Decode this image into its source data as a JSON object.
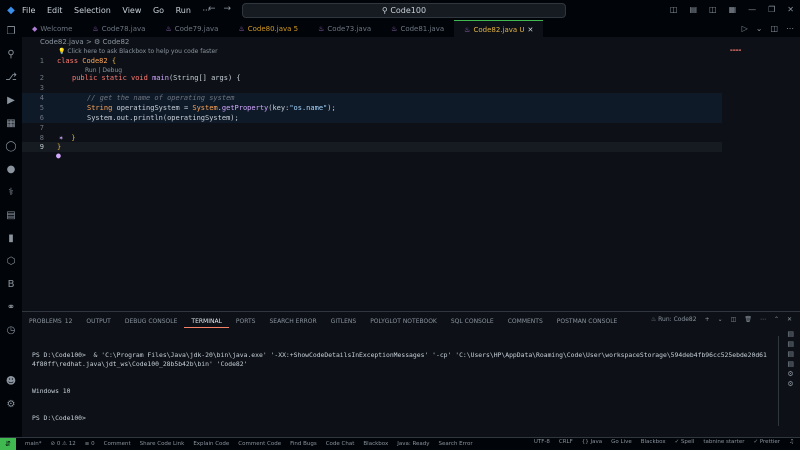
{
  "titlebar": {
    "menu": [
      "File",
      "Edit",
      "Selection",
      "View",
      "Go",
      "Run",
      "···"
    ],
    "search": "Code100"
  },
  "tabs": [
    {
      "label": "Welcome",
      "icon": "vscode-icon",
      "active": false,
      "modified": false
    },
    {
      "label": "Code78.java",
      "icon": "java-icon",
      "active": false,
      "modified": false
    },
    {
      "label": "Code79.java",
      "icon": "java-icon",
      "active": false,
      "modified": false
    },
    {
      "label": "Code80.java 5",
      "icon": "java-icon",
      "active": false,
      "modified": true
    },
    {
      "label": "Code73.java",
      "icon": "java-icon",
      "active": false,
      "modified": false
    },
    {
      "label": "Code81.java",
      "icon": "java-icon",
      "active": false,
      "modified": false
    },
    {
      "label": "Code82.java U",
      "icon": "java-icon",
      "active": true,
      "modified": true
    }
  ],
  "breadcrumb": "Code82.java > ⚙ Code82",
  "editor": {
    "hint": "💡 Click here to ask Blackbox to help you code faster",
    "codelens": "Run | Debug",
    "line_numbers": [
      "1",
      "2",
      "3",
      "4",
      "5",
      "6",
      "7",
      "8",
      "9"
    ],
    "code": {
      "l1_kw": "class ",
      "l1_cls": "Code82 ",
      "l1_brace": "{",
      "l2_mods": "public static void ",
      "l2_fn": "main",
      "l2_args": "(String[] args) {",
      "l4_comment": "// get the name of operating system",
      "l5_type": "String ",
      "l5_var": "operatingSystem = ",
      "l5_cls": "System",
      "l5_dot": ".",
      "l5_fn": "getProperty",
      "l5_open": "(key:",
      "l5_str": "\"os.name\"",
      "l5_close": ");",
      "l6_code": "System.out.println(operatingSystem);",
      "l8_brace": "}",
      "l9_brace": "}"
    }
  },
  "panel": {
    "tabs": [
      "PROBLEMS",
      "OUTPUT",
      "DEBUG CONSOLE",
      "TERMINAL",
      "PORTS",
      "SEARCH ERROR",
      "GITLENS",
      "POLYGLOT NOTEBOOK",
      "SQL CONSOLE",
      "COMMENTS",
      "POSTMAN CONSOLE"
    ],
    "problems_count": "12",
    "active_tab": "TERMINAL",
    "run_label": "Run: Code82",
    "terminal": {
      "line1": "PS D:\\Code100>  & 'C:\\Program Files\\Java\\jdk-20\\bin\\java.exe' '-XX:+ShowCodeDetailsInExceptionMessages' '-cp' 'C:\\Users\\HP\\AppData\\Roaming\\Code\\User\\workspaceStorage\\594deb4fb96cc525ebde20d614f80ff\\redhat.java\\jdt_ws\\Code100_28b5b42b\\bin' 'Code82'",
      "line2": "Windows 10",
      "line3": "PS D:\\Code100>"
    }
  },
  "statusbar": {
    "left": [
      "main*",
      "⊘ 0 ⚠ 12",
      "≡ 0",
      "Comment",
      "Share Code Link",
      "Explain Code",
      "Comment Code",
      "Find Bugs",
      "Code Chat",
      "Blackbox",
      "Java: Ready",
      "Search Error"
    ],
    "right": [
      "UTF-8",
      "CRLF",
      "{} Java",
      "Go Live",
      "Blackbox",
      "✓ Spell",
      "tabnine starter",
      "✓ Prettier"
    ]
  },
  "colors": {
    "background": "#0d1117",
    "accent": "#3fb950",
    "keyword": "#ff7b72",
    "function": "#d2a8ff",
    "string": "#a5d6ff"
  }
}
